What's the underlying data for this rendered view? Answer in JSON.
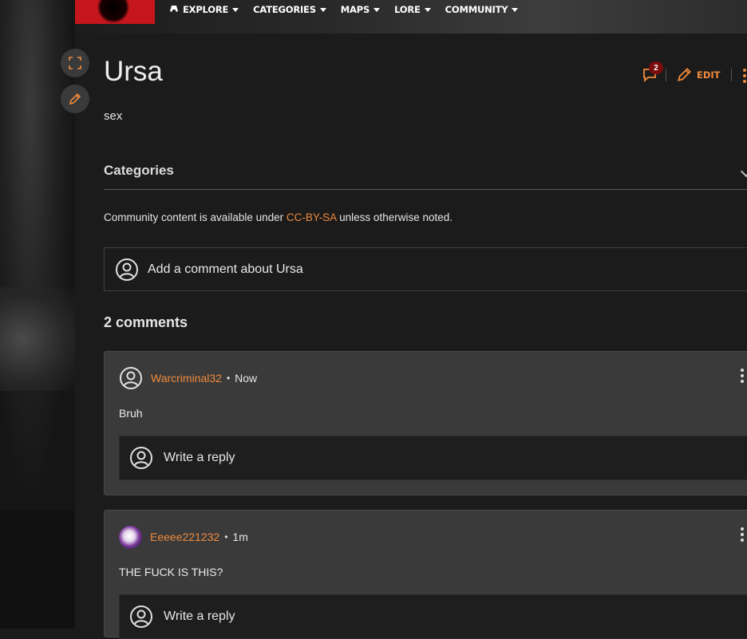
{
  "nav": {
    "items": [
      {
        "label": "EXPLORE",
        "icon": "gamepad-icon"
      },
      {
        "label": "CATEGORIES"
      },
      {
        "label": "MAPS"
      },
      {
        "label": "LORE"
      },
      {
        "label": "COMMUNITY"
      }
    ]
  },
  "page": {
    "title": "Ursa",
    "body": "sex",
    "comment_count_badge": "2",
    "edit_label": "EDIT"
  },
  "categories": {
    "label": "Categories"
  },
  "license": {
    "prefix": "Community content is available under ",
    "link": "CC-BY-SA",
    "suffix": " unless otherwise noted."
  },
  "add_comment": {
    "placeholder": "Add a comment about Ursa"
  },
  "comments": {
    "heading": "2 comments",
    "items": [
      {
        "author": "Warcriminal32",
        "time": "Now",
        "text": "Bruh",
        "reply_placeholder": "Write a reply"
      },
      {
        "author": "Eeeee221232",
        "time": "1m",
        "text": "THE FUCK IS THIS?",
        "reply_placeholder": "Write a reply"
      }
    ]
  },
  "colors": {
    "accent": "#f08a3c",
    "badge": "#7a0c0c",
    "background": "#1b1b1b",
    "comment_bg": "#3a3a3a"
  }
}
